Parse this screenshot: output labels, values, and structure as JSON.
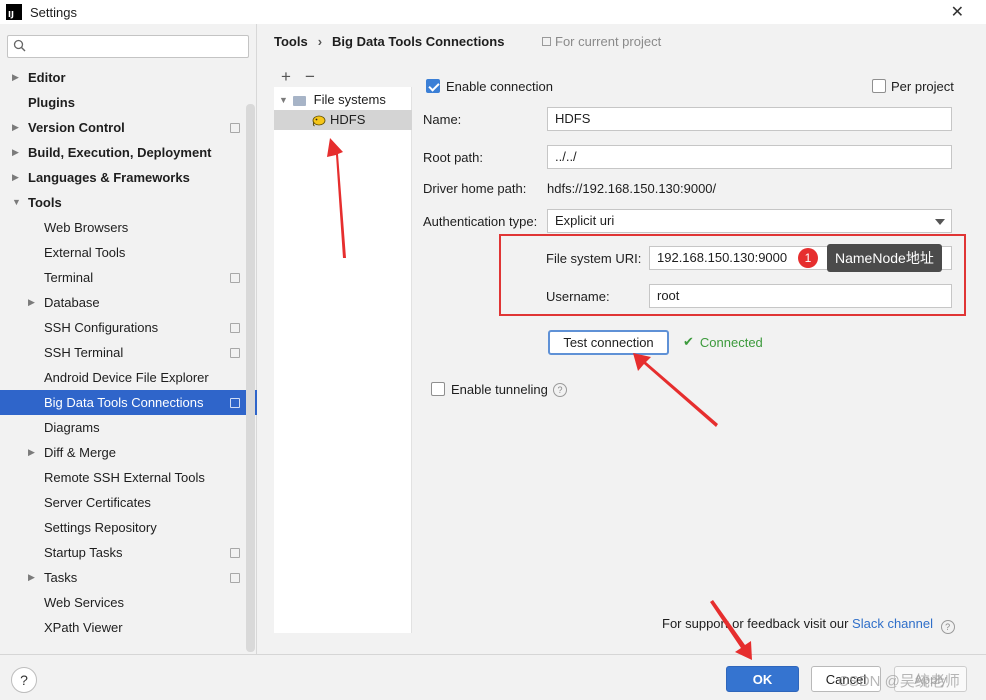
{
  "window": {
    "title": "Settings",
    "app_icon": "intellij-icon",
    "close_glyph": "✕"
  },
  "sidebar": {
    "search_placeholder": "",
    "items": [
      {
        "label": "Editor",
        "bold": true,
        "arrow": "right",
        "indent": 0
      },
      {
        "label": "Plugins",
        "bold": true,
        "arrow": "",
        "indent": 0
      },
      {
        "label": "Version Control",
        "bold": true,
        "arrow": "right",
        "indent": 0,
        "project": true
      },
      {
        "label": "Build, Execution, Deployment",
        "bold": true,
        "arrow": "right",
        "indent": 0
      },
      {
        "label": "Languages & Frameworks",
        "bold": true,
        "arrow": "right",
        "indent": 0
      },
      {
        "label": "Tools",
        "bold": true,
        "arrow": "down",
        "indent": 0
      },
      {
        "label": "Web Browsers",
        "indent": 1
      },
      {
        "label": "External Tools",
        "indent": 1
      },
      {
        "label": "Terminal",
        "indent": 1,
        "project": true
      },
      {
        "label": "Database",
        "indent": 1,
        "arrow": "right"
      },
      {
        "label": "SSH Configurations",
        "indent": 1,
        "project": true
      },
      {
        "label": "SSH Terminal",
        "indent": 1,
        "project": true
      },
      {
        "label": "Android Device File Explorer",
        "indent": 1
      },
      {
        "label": "Big Data Tools Connections",
        "indent": 1,
        "project": true,
        "selected": true
      },
      {
        "label": "Diagrams",
        "indent": 1
      },
      {
        "label": "Diff & Merge",
        "indent": 1,
        "arrow": "right"
      },
      {
        "label": "Remote SSH External Tools",
        "indent": 1
      },
      {
        "label": "Server Certificates",
        "indent": 1
      },
      {
        "label": "Settings Repository",
        "indent": 1
      },
      {
        "label": "Startup Tasks",
        "indent": 1,
        "project": true
      },
      {
        "label": "Tasks",
        "indent": 1,
        "arrow": "right",
        "project": true
      },
      {
        "label": "Web Services",
        "indent": 1
      },
      {
        "label": "XPath Viewer",
        "indent": 1
      }
    ]
  },
  "header": {
    "breadcrumb": [
      "Tools",
      "Big Data Tools Connections"
    ],
    "breadcrumb_sep": "›",
    "scope": "For current project"
  },
  "connections_tree": {
    "add": "+",
    "remove": "−",
    "root_label": "File systems",
    "child_label": "HDFS"
  },
  "form": {
    "enable_connection_label": "Enable connection",
    "enable_connection_checked": true,
    "per_project_label": "Per project",
    "per_project_checked": false,
    "name_label": "Name:",
    "name_value": "HDFS",
    "root_path_label": "Root path:",
    "root_path_value": "../../",
    "driver_home_label": "Driver home path:",
    "driver_home_value": "hdfs://192.168.150.130:9000/",
    "auth_type_label": "Authentication type:",
    "auth_type_value": "Explicit uri",
    "fs_uri_label": "File system URI:",
    "fs_uri_value": "192.168.150.130:9000",
    "username_label": "Username:",
    "username_value": "root",
    "test_connection_label": "Test connection",
    "connected_glyph": "✔",
    "connected_label": "Connected",
    "enable_tunneling_label": "Enable tunneling",
    "enable_tunneling_checked": false
  },
  "annotation": {
    "badge": "1",
    "tooltip": "NameNode地址",
    "color": "#e03535"
  },
  "footer": {
    "support_text": "For support or feedback visit our",
    "slack_link": "Slack channel",
    "help": "?",
    "ok": "OK",
    "cancel": "Cancel",
    "apply": "Apply"
  },
  "watermark": "CSDN @吴统老师",
  "colors": {
    "accent": "#2f65ca",
    "ok": "#3574d0",
    "connected": "#3c9a3c",
    "link": "#2f6fc9"
  }
}
